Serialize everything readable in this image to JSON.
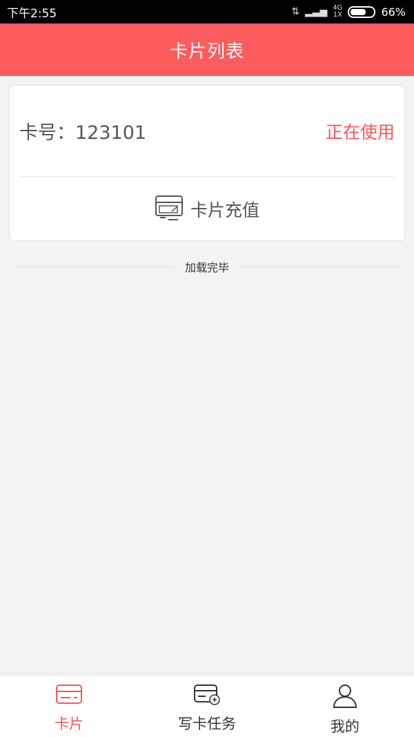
{
  "status_bar": {
    "time": "下午2:55",
    "network": "4G",
    "sim": "1X",
    "battery_percent": "66%",
    "battery_level": 0.66
  },
  "header": {
    "title": "卡片列表"
  },
  "card": {
    "number_text": "卡号：123101",
    "status_text": "正在使用",
    "recharge_label": "卡片充值"
  },
  "list_footer": {
    "text": "加载完毕"
  },
  "tabbar": {
    "tabs": [
      {
        "label": "卡片",
        "icon": "card-icon",
        "active": true
      },
      {
        "label": "写卡任务",
        "icon": "write-card-icon",
        "active": false
      },
      {
        "label": "我的",
        "icon": "user-icon",
        "active": false
      }
    ]
  },
  "colors": {
    "accent": "#fd5c5f",
    "active_text": "#f0585b",
    "background": "#f3f3f3"
  }
}
